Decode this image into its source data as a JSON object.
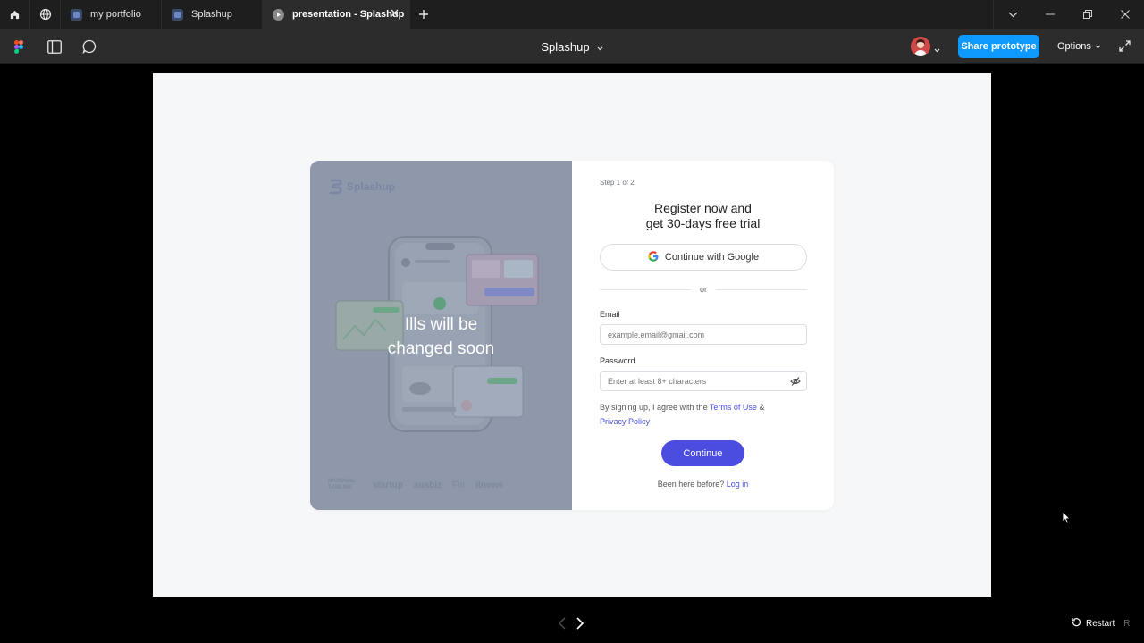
{
  "tabs": [
    {
      "label": "my portfolio",
      "icon": "figma-file-icon"
    },
    {
      "label": "Splashup",
      "icon": "figma-file-icon"
    },
    {
      "label": "presentation - Splashup",
      "icon": "play-icon",
      "active": true
    }
  ],
  "toolbar": {
    "file_title": "Splashup",
    "share_label": "Share prototype",
    "options_label": "Options"
  },
  "colors": {
    "accent": "#0d99ff",
    "primary_button": "#4b4ce0",
    "left_pane": "#8e98aa",
    "link": "#4b4fe0"
  },
  "left_pane": {
    "brand": "Splashup",
    "ills_line1": "Ills will be",
    "ills_line2": "changed soon",
    "logos": [
      "NATIONAL TRIBUNE",
      "startup",
      "ausbiz",
      "Fin",
      "itnews"
    ]
  },
  "form": {
    "step": "Step 1 of 2",
    "heading_line1": "Register now and",
    "heading_line2": "get 30-days free trial",
    "google_label": "Continue with Google",
    "divider": "or",
    "email_label": "Email",
    "email_placeholder": "example.email@gmail.com",
    "password_label": "Password",
    "password_placeholder": "Enter at least 8+ characters",
    "terms_prefix": "By signing up, I agree with the ",
    "terms_link": "Terms of Use",
    "terms_amp": " &",
    "privacy_link": "Privacy Policy",
    "continue_label": "Continue",
    "login_prefix": "Been here before? ",
    "login_link": "Log in"
  },
  "footer": {
    "restart_label": "Restart",
    "restart_key": "R"
  }
}
